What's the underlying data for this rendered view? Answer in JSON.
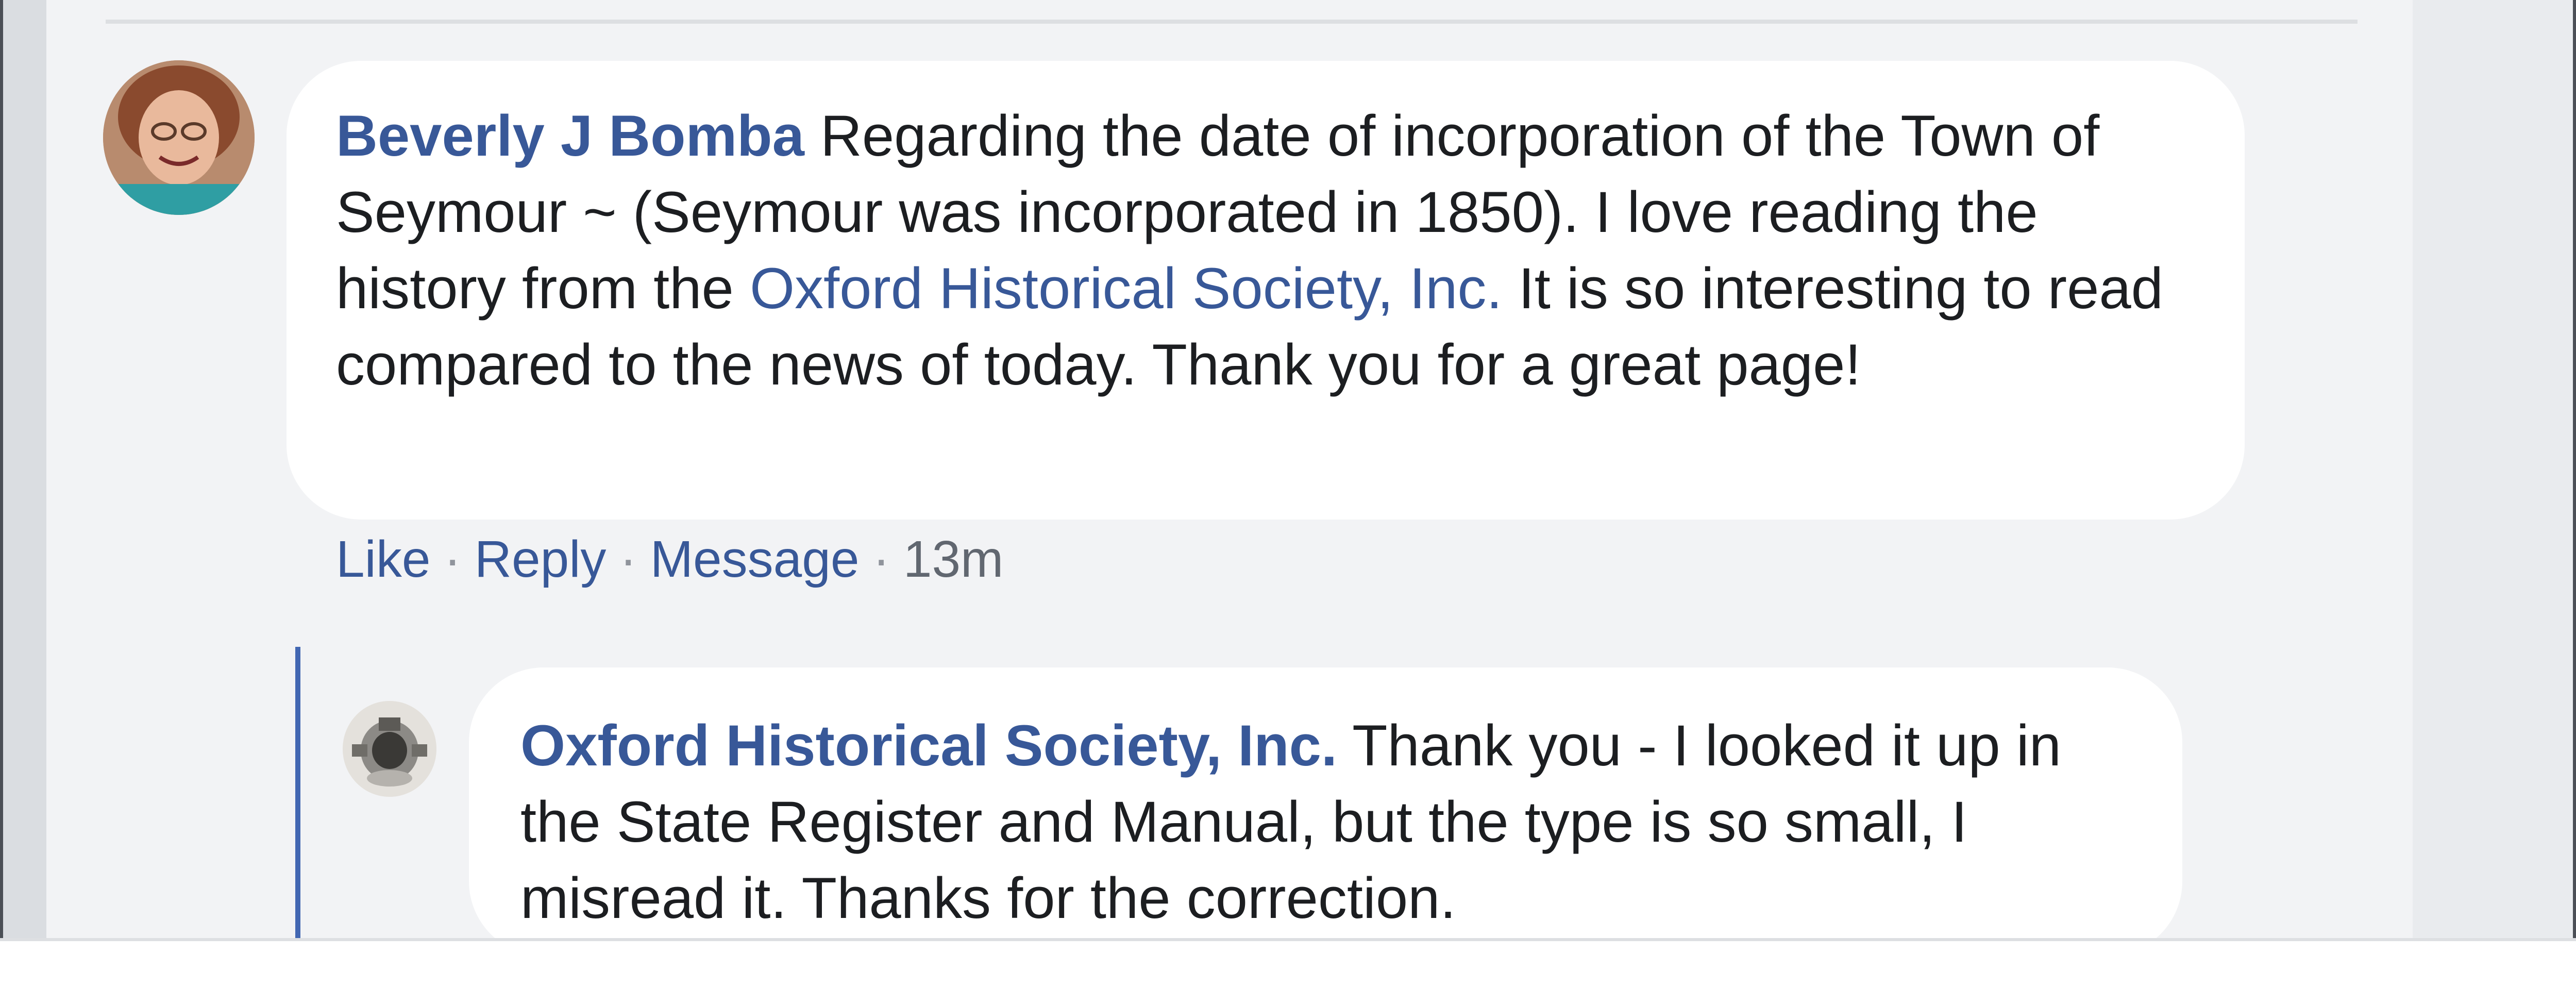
{
  "comment": {
    "author": "Beverly J Bomba",
    "text_before_mention": "Regarding the date of incorporation of the Town of Seymour ~ (Seymour was incorporated in 1850). I love reading the history from the",
    "mention": "Oxford Historical Society, Inc.",
    "text_after_mention": "It is so interesting to read compared to the news of today. Thank you for a great page!",
    "actions": {
      "like_label": "Like",
      "reply_label": "Reply",
      "message_label": "Message",
      "separator": "·",
      "timestamp": "13m"
    }
  },
  "reply": {
    "author": "Oxford Historical Society, Inc.",
    "text": "Thank you - I looked it up in the State Register and Manual, but the type is so small, I misread it. Thanks for the correction."
  },
  "colors": {
    "link": "#385898",
    "thread_line": "#4267b2",
    "bubble": "#ffffff",
    "panel": "#f2f3f5"
  }
}
